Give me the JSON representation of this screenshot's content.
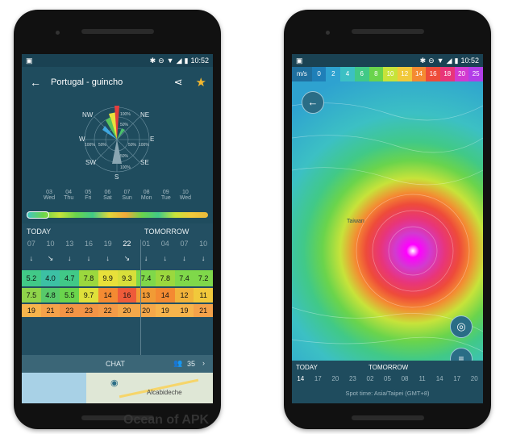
{
  "left_phone": {
    "status_time": "10:52",
    "location_title": "Portugal - guincho",
    "compass": {
      "nw": "NW",
      "ne": "NE",
      "w": "W",
      "e": "E",
      "sw": "SW",
      "se": "SE",
      "s": "S",
      "pct_outer": "100%",
      "pct_mid": "50%",
      "pct_mid_top": "50%",
      "pct_top": "100%",
      "pct_left_outer": "100%",
      "pct_left_mid": "50%",
      "pct_right_mid": "50%",
      "pct_right_outer": "100%",
      "pct_bottom_mid": "50%",
      "pct_bottom_outer": "100%"
    },
    "week_days": [
      {
        "num": "03",
        "name": "Wed"
      },
      {
        "num": "04",
        "name": "Thu"
      },
      {
        "num": "05",
        "name": "Fri"
      },
      {
        "num": "06",
        "name": "Sat"
      },
      {
        "num": "07",
        "name": "Sun"
      },
      {
        "num": "08",
        "name": "Mon"
      },
      {
        "num": "09",
        "name": "Tue"
      },
      {
        "num": "10",
        "name": "Wed"
      }
    ],
    "today_label": "TODAY",
    "tomorrow_label": "TOMORROW",
    "hours": [
      "07",
      "10",
      "13",
      "16",
      "19",
      "22",
      "01",
      "04",
      "07",
      "10"
    ],
    "arrows": [
      "↓",
      "↘",
      "↓",
      "↓",
      "↓",
      "↘",
      "↓",
      "↓",
      "↓",
      "↓"
    ],
    "wind": [
      "5.2",
      "4.0",
      "4.7",
      "7.8",
      "9.9",
      "9.3",
      "7.4",
      "7.8",
      "7.4",
      "7.2"
    ],
    "gust": [
      "7.5",
      "4.8",
      "5.5",
      "9.7",
      "14",
      "16",
      "13",
      "14",
      "12",
      "11"
    ],
    "temp": [
      "19",
      "21",
      "23",
      "23",
      "22",
      "20",
      "20",
      "19",
      "19",
      "21"
    ],
    "chat_label": "CHAT",
    "chat_count": "35",
    "map_place": "Alcabideche",
    "colors": {
      "wind_row": "#7fd84a",
      "gust_row": "#f0a23a",
      "temp_row": "#f5a04a"
    }
  },
  "right_phone": {
    "status_time": "10:52",
    "scale_unit": "m/s",
    "scale_values": [
      "0",
      "2",
      "4",
      "6",
      "8",
      "10",
      "12",
      "14",
      "16",
      "18",
      "20",
      "25"
    ],
    "scale_colors": [
      "#1f7fb8",
      "#2ea2d0",
      "#3cc0c4",
      "#41c987",
      "#6ad44c",
      "#c7e33a",
      "#f1c93b",
      "#f48a32",
      "#ee4b3a",
      "#e8357a",
      "#d23ad0",
      "#b23ee8"
    ],
    "map_label": "Taiwan",
    "today_label": "TODAY",
    "tomorrow_label": "TOMORROW",
    "hours": [
      "14",
      "17",
      "20",
      "23",
      "02",
      "05",
      "08",
      "11",
      "14",
      "17",
      "20"
    ],
    "spot_time": "Spot time: Asia/Taipei (GMT+8)"
  },
  "watermark": "Ocean of APK"
}
